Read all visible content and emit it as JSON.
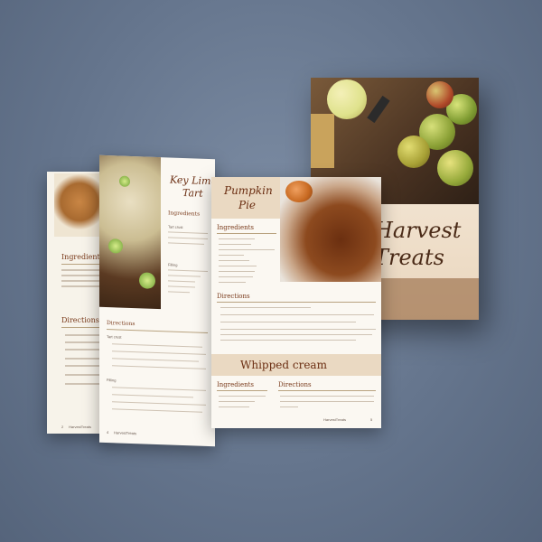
{
  "cover": {
    "title_line1": "Harvest",
    "title_line2": "Treats"
  },
  "pages": {
    "left_under": {
      "ingredients_heading": "Ingredients",
      "directions_heading": "Directions",
      "page_number": "2",
      "footer": "HarvestTreats"
    },
    "left": {
      "title_line1": "Key Lime",
      "title_line2": "Tart",
      "ingredients_heading": "Ingredients",
      "tart_crust": "Tart crust",
      "filling": "Filling",
      "directions_heading": "Directions",
      "directions_tart_crust": "Tart crust",
      "directions_filling": "Filling",
      "page_number": "4",
      "footer": "HarvestTreats"
    },
    "right": {
      "title_line1": "Pumpkin",
      "title_line2": "Pie",
      "ingredients_heading": "Ingredients",
      "directions_heading": "Directions",
      "whipped_title": "Whipped cream",
      "whipped_ingredients": "Ingredients",
      "whipped_directions": "Directions",
      "footer": "HarvestTreats",
      "page_number": "5"
    }
  },
  "colors": {
    "background": "#6a7a92",
    "accent": "#7a3b1c",
    "band": "#ead9c2"
  }
}
